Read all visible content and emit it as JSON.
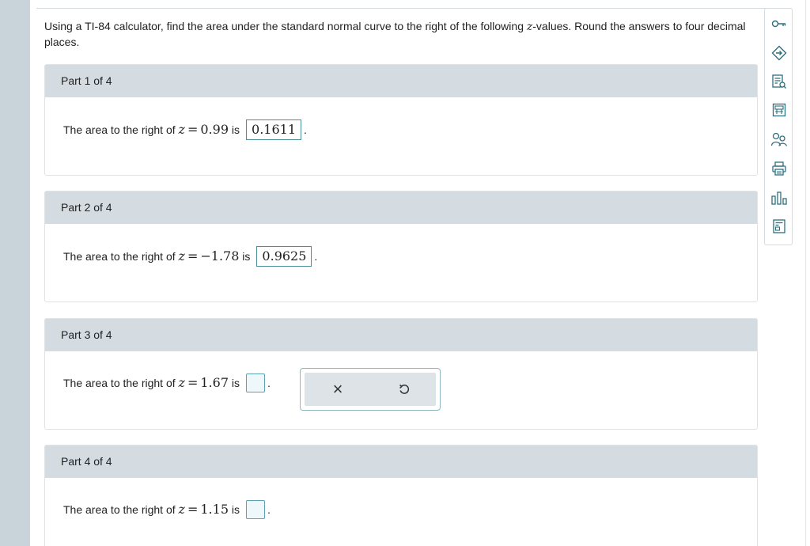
{
  "instructions": {
    "pre": "Using a TI-84 calculator, find the area under the standard normal curve to the right of the following ",
    "z": "z",
    "post": "-values. Round the answers to four decimal places."
  },
  "parts": [
    {
      "header": "Part 1 of 4",
      "prompt": "The area to the right of",
      "var": "z",
      "eq": "=",
      "value": "0.99",
      "is": "is",
      "answer": "0.1611",
      "period": "."
    },
    {
      "header": "Part 2 of 4",
      "prompt": "The area to the right of",
      "var": "z",
      "eq": "=",
      "value": "−1.78",
      "is": "is",
      "answer": "0.9625",
      "period": "."
    },
    {
      "header": "Part 3 of 4",
      "prompt": "The area to the right of",
      "var": "z",
      "eq": "=",
      "value": "1.67",
      "is": "is",
      "answer": "",
      "period": "."
    },
    {
      "header": "Part 4 of 4",
      "prompt": "The area to the right of",
      "var": "z",
      "eq": "=",
      "value": "1.15",
      "is": "is",
      "answer": "",
      "period": "."
    }
  ],
  "answer_tools": {
    "clear": "×",
    "undo": "↺"
  },
  "sidebar_icons": [
    "key-icon",
    "answer-icon",
    "search-notes-icon",
    "calculator-icon",
    "help-people-icon",
    "print-icon",
    "data-chart-icon",
    "table-icon"
  ],
  "colors": {
    "accent": "#4a8f9a",
    "header_bg": "#d5dce1",
    "rail": "#c9d3da"
  }
}
